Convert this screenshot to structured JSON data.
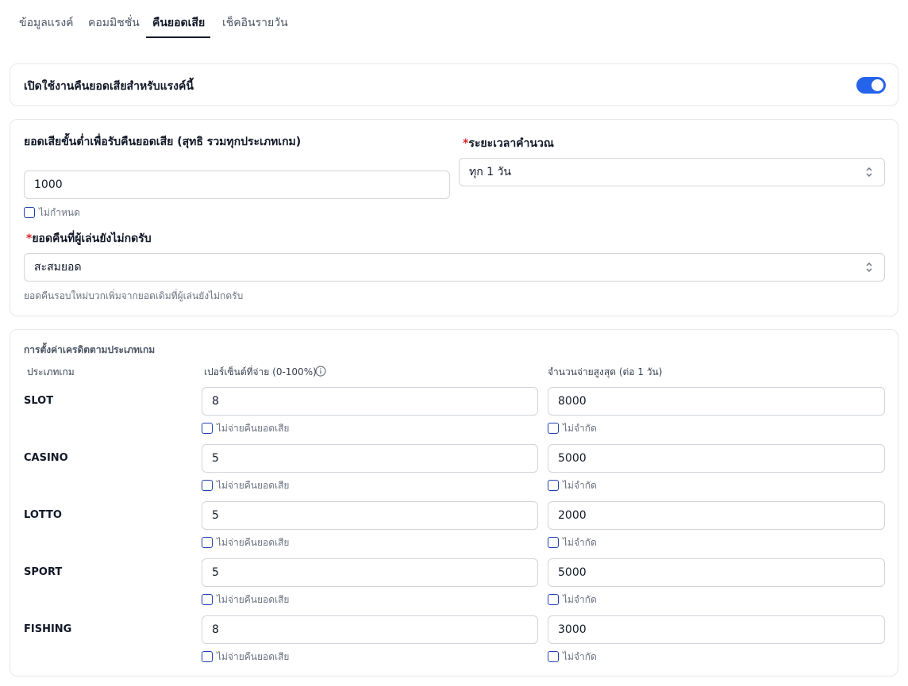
{
  "tabs": [
    {
      "label": "ข้อมูลแรงค์"
    },
    {
      "label": "คอมมิชชั่น"
    },
    {
      "label": "คืนยอดเสีย"
    },
    {
      "label": "เช็คอินรายวัน"
    }
  ],
  "enable": {
    "label": "เปิดใช้งานคืนยอดเสียสำหรับแรงค์นี้",
    "enabled": true
  },
  "settings": {
    "min_loss_label": "ยอดเสียขั้นต่ำเพื่อรับคืนยอดเสีย (สุทธิ รวมทุกประเภทเกม)",
    "min_loss_value": "1000",
    "min_loss_unlimited_label": "ไม่กำหนด",
    "required_mark": "*",
    "period_label": "ระยะเวลาคำนวณ",
    "period_value": "ทุก 1 วัน",
    "unclaimed_label": "ยอดคืนที่ผู้เล่นยังไม่กดรับ",
    "unclaimed_value": "สะสมยอด",
    "unclaimed_help": "ยอดคืนรอบใหม่บวกเพิ่มจากยอดเดิมที่ผู้เล่นยังไม่กดรับ"
  },
  "credit": {
    "section_title": "การตั้งค่าเครดิตตามประเภทเกม",
    "col_type": "ประเภทเกม",
    "col_percent": "เปอร์เซ็นต์ที่จ่าย (0-100%)",
    "col_max": "จำนวนจ่ายสูงสุด (ต่อ 1 วัน)",
    "no_pay_label": "ไม่จ่ายคืนยอดเสีย",
    "no_limit_label": "ไม่จำกัด",
    "rows": [
      {
        "name": "SLOT",
        "percent": "8",
        "max": "8000"
      },
      {
        "name": "CASINO",
        "percent": "5",
        "max": "5000"
      },
      {
        "name": "LOTTO",
        "percent": "5",
        "max": "2000"
      },
      {
        "name": "SPORT",
        "percent": "5",
        "max": "5000"
      },
      {
        "name": "FISHING",
        "percent": "8",
        "max": "3000"
      }
    ]
  },
  "colors": {
    "accent": "#2563eb",
    "required": "#dc2626"
  }
}
